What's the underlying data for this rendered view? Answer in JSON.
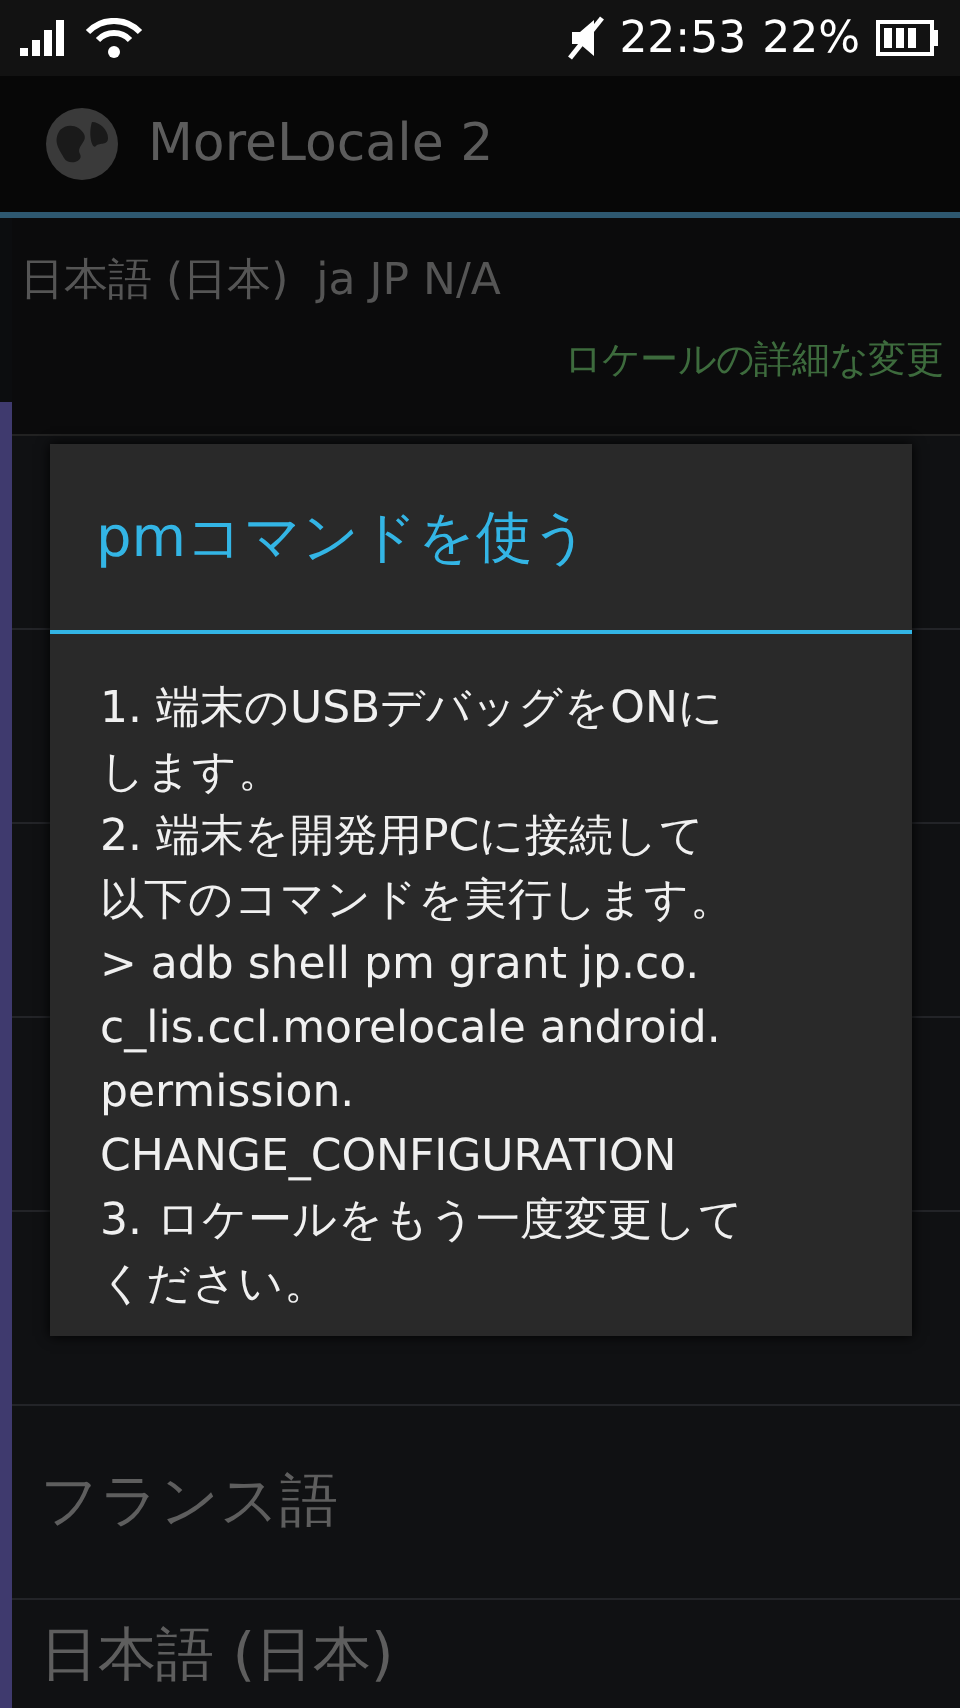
{
  "status_bar": {
    "time": "22:53",
    "battery_percent": "22%"
  },
  "action_bar": {
    "title": "MoreLocale 2"
  },
  "current_locale": {
    "label": "日本語 (日本)  ja JP N/A",
    "link": "ロケールの詳細な変更"
  },
  "locale_list": [
    {
      "kind": "covered"
    },
    {
      "kind": "covered"
    },
    {
      "kind": "covered"
    },
    {
      "kind": "covered"
    },
    {
      "kind": "covered"
    },
    {
      "kind": "text",
      "label": "フランス語"
    },
    {
      "kind": "text",
      "label": "日本語 (日本)"
    }
  ],
  "dialog": {
    "title": "pmコマンドを使う",
    "message_lines": [
      "1. 端末のUSBデバッグをONに",
      "します。",
      "2. 端末を開発用PCに接続して",
      "以下のコマンドを実行します。",
      "> adb shell pm grant jp.co.",
      "c_lis.ccl.morelocale android.",
      "permission.",
      "CHANGE_CONFIGURATION",
      "3. ロケールをもう一度変更して",
      "ください。"
    ]
  }
}
